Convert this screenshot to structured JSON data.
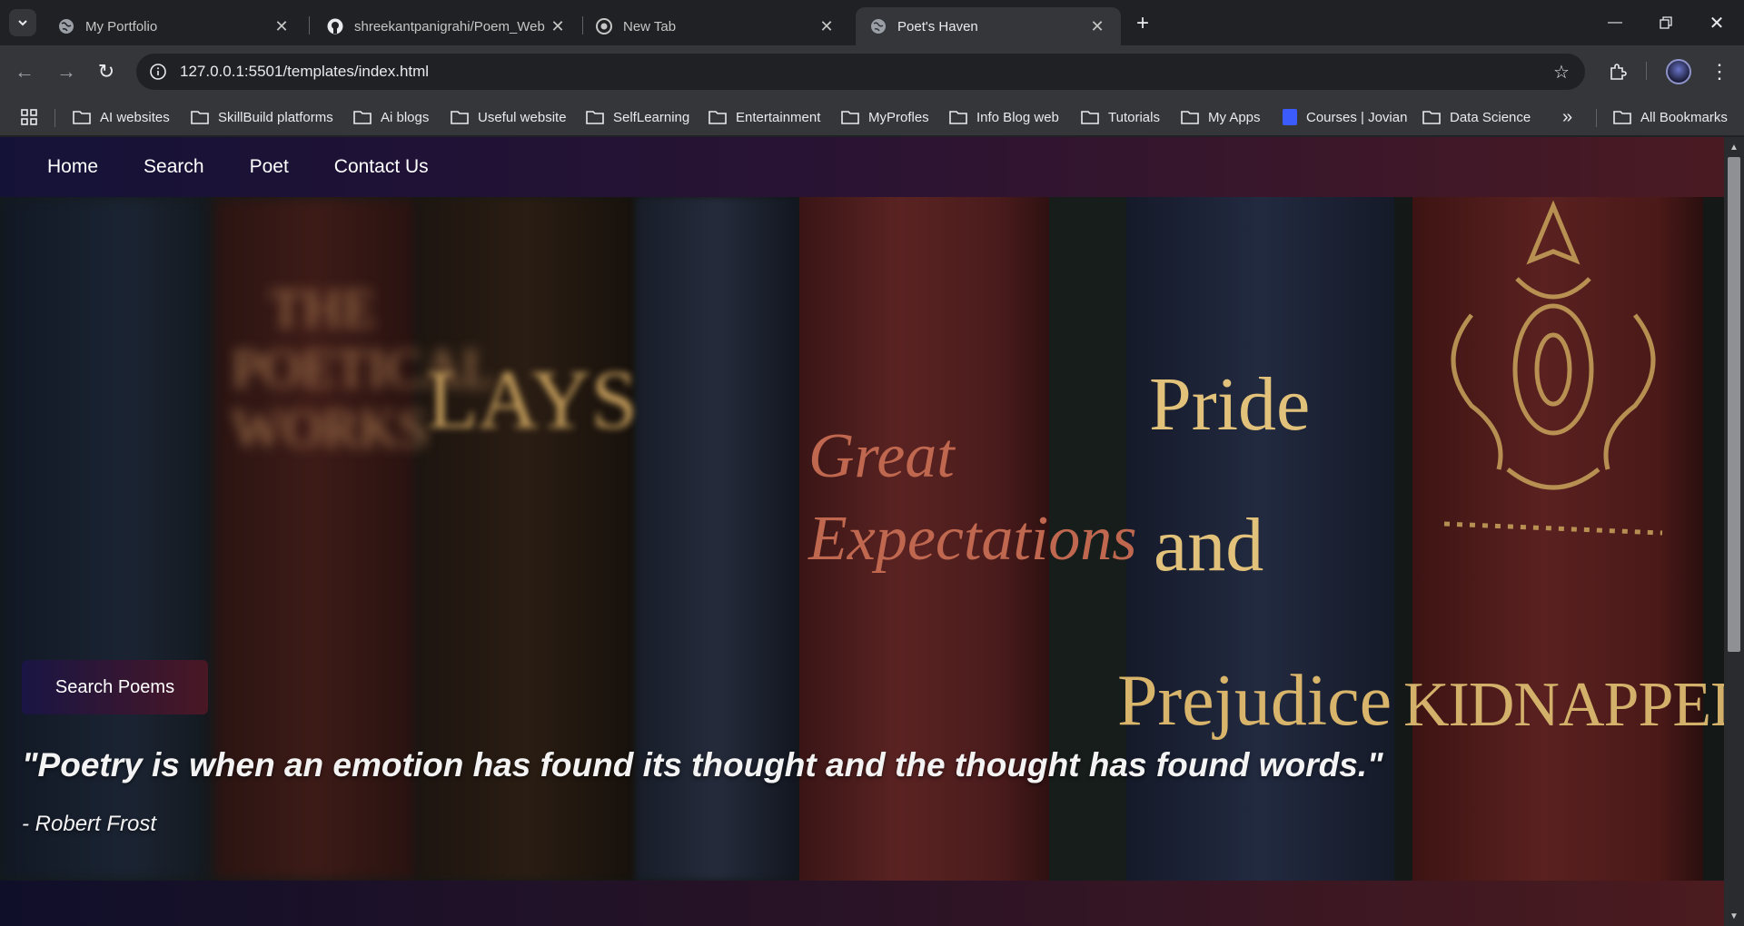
{
  "browser": {
    "tabs": [
      {
        "title": "My Portfolio",
        "active": false
      },
      {
        "title": "shreekantpanigrahi/Poem_Web",
        "active": false
      },
      {
        "title": "New Tab",
        "active": false
      },
      {
        "title": "Poet's Haven",
        "active": true
      }
    ],
    "url": "127.0.0.1:5501/templates/index.html",
    "bookmarks": [
      "AI websites",
      "SkillBuild platforms",
      "Ai blogs",
      "Useful website",
      "SelfLearning",
      "Entertainment",
      "MyProfles",
      "Info Blog web",
      "Tutorials",
      "My Apps",
      "Courses | Jovian",
      "Data Science"
    ],
    "all_bookmarks": "All Bookmarks",
    "more_bookmarks": "»"
  },
  "site": {
    "nav": [
      "Home",
      "Search",
      "Poet",
      "Contact Us"
    ],
    "search_button": "Search Poems",
    "quote": "\"Poetry is when an emotion has found its thought and the thought has found words.\"",
    "author": "- Robert Frost",
    "spines": [
      "THE POETICAL WORKS",
      "LAYS",
      "Great Expectations",
      "Pride",
      "and",
      "Prejudice",
      "KIDNAPPED"
    ]
  },
  "colors": {
    "nav_gradient_start": "#151238",
    "nav_gradient_end": "#4a1a22",
    "chrome_dark": "#202124",
    "chrome_mid": "#35363a"
  }
}
